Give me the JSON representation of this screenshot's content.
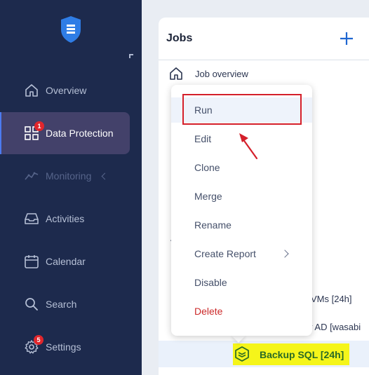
{
  "sidebar": {
    "items": [
      {
        "label": "Overview",
        "icon": "home-icon"
      },
      {
        "label": "Data Protection",
        "icon": "grid-icon",
        "badge": "1",
        "active": true
      },
      {
        "label": "Monitoring",
        "icon": "activity-line-icon",
        "disabled": true
      },
      {
        "label": "Activities",
        "icon": "inbox-icon"
      },
      {
        "label": "Calendar",
        "icon": "calendar-icon"
      },
      {
        "label": "Search",
        "icon": "search-icon"
      },
      {
        "label": "Settings",
        "icon": "gear-icon",
        "badge": "5"
      }
    ]
  },
  "jobs": {
    "title": "Jobs",
    "overview_label": "Job overview",
    "partial_rows": [
      "VMs [24h]",
      "y AD [wasabi"
    ],
    "selected_job": "Backup SQL [24h]"
  },
  "menu": {
    "items": [
      "Run",
      "Edit",
      "Clone",
      "Merge",
      "Rename",
      "Create Report",
      "Disable",
      "Delete"
    ]
  },
  "colors": {
    "sidebar_bg": "#1d2a4d",
    "active_item_bg": "#43416a",
    "accent_blue": "#1f66d1",
    "badge_red": "#e0262c",
    "delete_red": "#cc2a2a",
    "annotation_red": "#d41f2a",
    "highlight_yellow": "#f5f51a",
    "job_green": "#2a6a26"
  }
}
